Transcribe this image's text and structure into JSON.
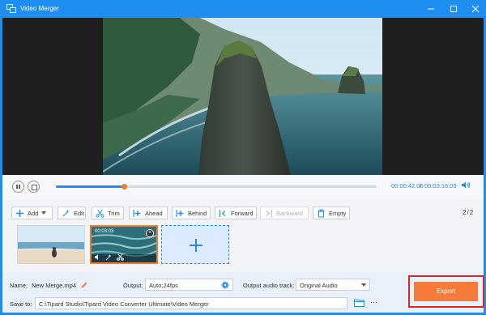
{
  "window": {
    "title": "Video Merger",
    "icons": [
      "app-icon",
      "minimize-icon",
      "maximize-icon",
      "close-icon"
    ]
  },
  "player": {
    "current_time": "00:00:42.06",
    "separator": "/",
    "total_time": "00:03:16.09",
    "progress": 0.213
  },
  "toolbar": {
    "add": "Add",
    "edit": "Edit",
    "trim": "Trim",
    "ahead": "Ahead",
    "behind": "Behind",
    "forward": "Forward",
    "backward": "Backward",
    "empty": "Empty",
    "page_current": "2",
    "page_sep": "/",
    "page_total": "2"
  },
  "clips": [
    {
      "kind": "beach"
    },
    {
      "kind": "waves",
      "time": "00:03:03",
      "selected": true
    }
  ],
  "output": {
    "name_label": "Name:",
    "name_value": "New Merge.mp4",
    "output_label": "Output:",
    "output_value": "Auto;24fps",
    "audio_label": "Output audio track:",
    "audio_value": "Original Audio",
    "save_label": "Save to:",
    "save_path": "C:\\Tipard Studio\\Tipard Video Converter Ultimate\\Video Merger",
    "dots": "···"
  },
  "export": {
    "label": "Export"
  },
  "colors": {
    "accent": "#1e8ef0",
    "orange": "#f47b3a",
    "highlight": "#d32a1f"
  }
}
